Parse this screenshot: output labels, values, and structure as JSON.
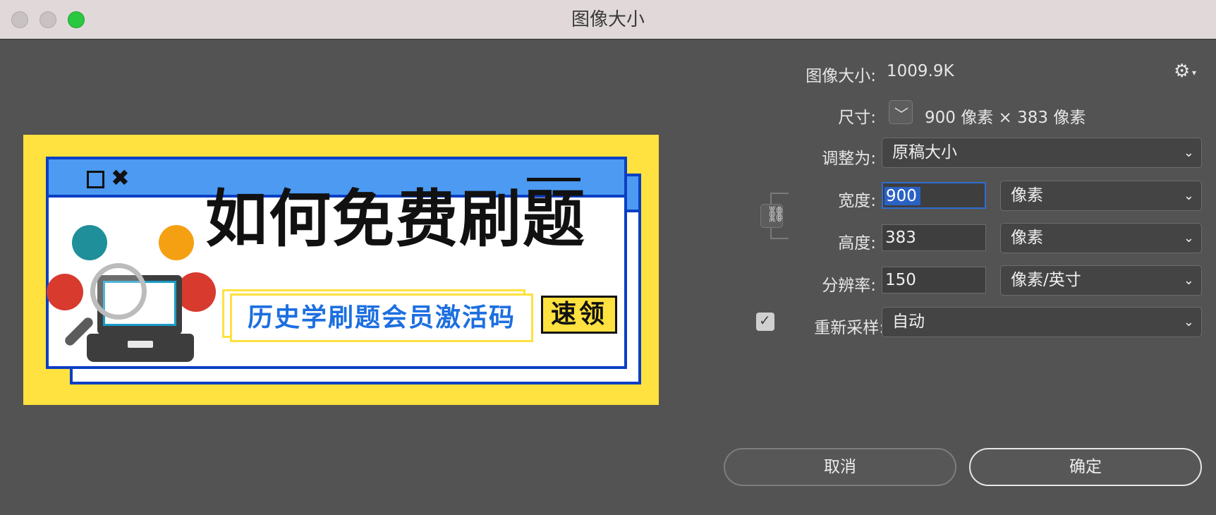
{
  "window": {
    "title": "图像大小"
  },
  "preview": {
    "headline": "如何免费刷题",
    "subtitle": "历史学刷题会员激活码",
    "cta": "速领",
    "window_controls": {
      "square": "□",
      "close": "✖"
    },
    "colors": {
      "background": "#ffe13f",
      "frame": "#0b3fc4",
      "bar": "#4c9af2",
      "subtitle": "#1c6fe0"
    }
  },
  "info": {
    "image_size_label": "图像大小:",
    "image_size_value": "1009.9K",
    "dimensions_label": "尺寸:",
    "dimensions_value": "900 像素  ×  383 像素"
  },
  "fit_to": {
    "label": "调整为:",
    "value": "原稿大小"
  },
  "width": {
    "label": "宽度:",
    "value": "900",
    "unit": "像素"
  },
  "height": {
    "label": "高度:",
    "value": "383",
    "unit": "像素"
  },
  "resolution": {
    "label": "分辨率:",
    "value": "150",
    "unit": "像素/英寸"
  },
  "resample": {
    "checked": true,
    "label": "重新采样:",
    "value": "自动"
  },
  "buttons": {
    "cancel": "取消",
    "ok": "确定"
  },
  "icons": {
    "gear": "gear-icon",
    "link": "link-icon",
    "chevron": "chevron-down-icon"
  }
}
